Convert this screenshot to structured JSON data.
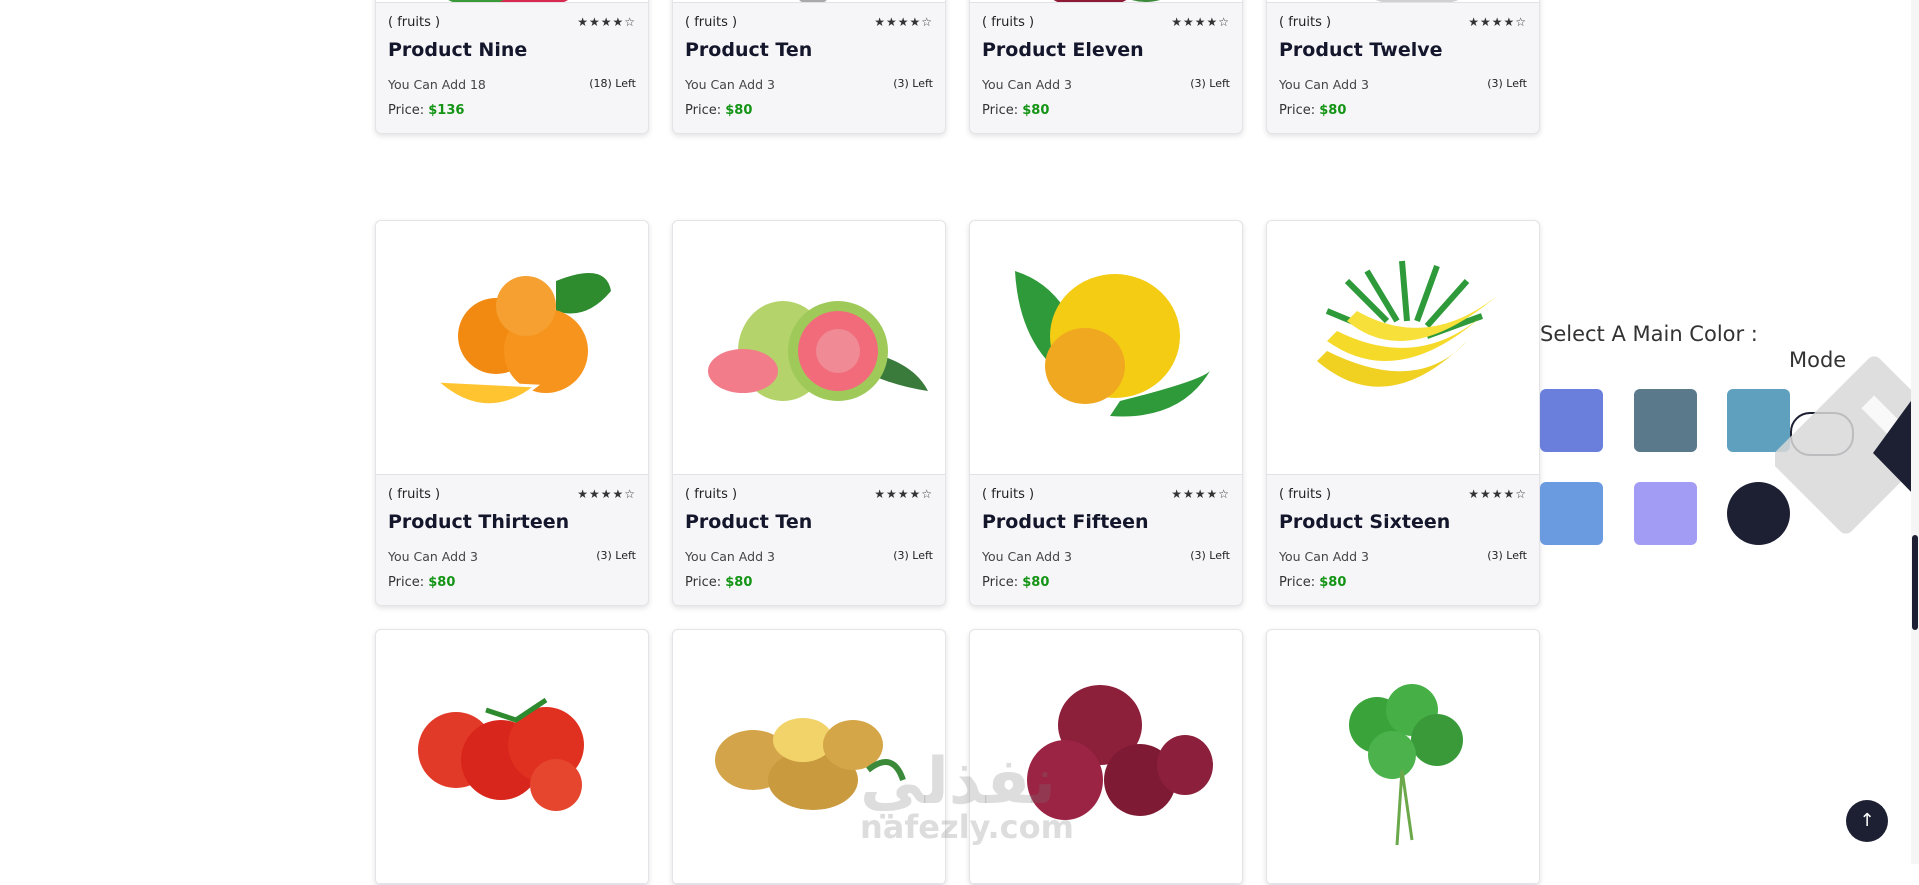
{
  "products_row1": [
    {
      "category": "( fruits )",
      "name": "Product Nine",
      "can_add": "You Can Add 18",
      "left": "(18) Left",
      "price_label": "Price:",
      "price": "$136"
    },
    {
      "category": "( fruits )",
      "name": "Product Ten",
      "can_add": "You Can Add 3",
      "left": "(3) Left",
      "price_label": "Price:",
      "price": "$80"
    },
    {
      "category": "( fruits )",
      "name": "Product Eleven",
      "can_add": "You Can Add 3",
      "left": "(3) Left",
      "price_label": "Price:",
      "price": "$80"
    },
    {
      "category": "( fruits )",
      "name": "Product Twelve",
      "can_add": "You Can Add 3",
      "left": "(3) Left",
      "price_label": "Price:",
      "price": "$80"
    }
  ],
  "products_row2": [
    {
      "category": "( fruits )",
      "name": "Product Thirteen",
      "can_add": "You Can Add 3",
      "left": "(3) Left",
      "price_label": "Price:",
      "price": "$80"
    },
    {
      "category": "( fruits )",
      "name": "Product Ten",
      "can_add": "You Can Add 3",
      "left": "(3) Left",
      "price_label": "Price:",
      "price": "$80"
    },
    {
      "category": "( fruits )",
      "name": "Product Fifteen",
      "can_add": "You Can Add 3",
      "left": "(3) Left",
      "price_label": "Price:",
      "price": "$80"
    },
    {
      "category": "( fruits )",
      "name": "Product Sixteen",
      "can_add": "You Can Add 3",
      "left": "(3) Left",
      "price_label": "Price:",
      "price": "$80"
    }
  ],
  "rating_stars": "★★★★☆",
  "settings": {
    "title": "Select A Main Color :",
    "mode_label": "Mode",
    "colors": [
      "#6a7fdb",
      "#5a7a8c",
      "#5ea0bd",
      "#6a9ae0",
      "#a39cf5",
      "#1d2033"
    ]
  },
  "watermark": {
    "arabic": "نفذلي",
    "latin": "nafezly.com"
  },
  "scroll_up_icon": "arrow-up-icon"
}
